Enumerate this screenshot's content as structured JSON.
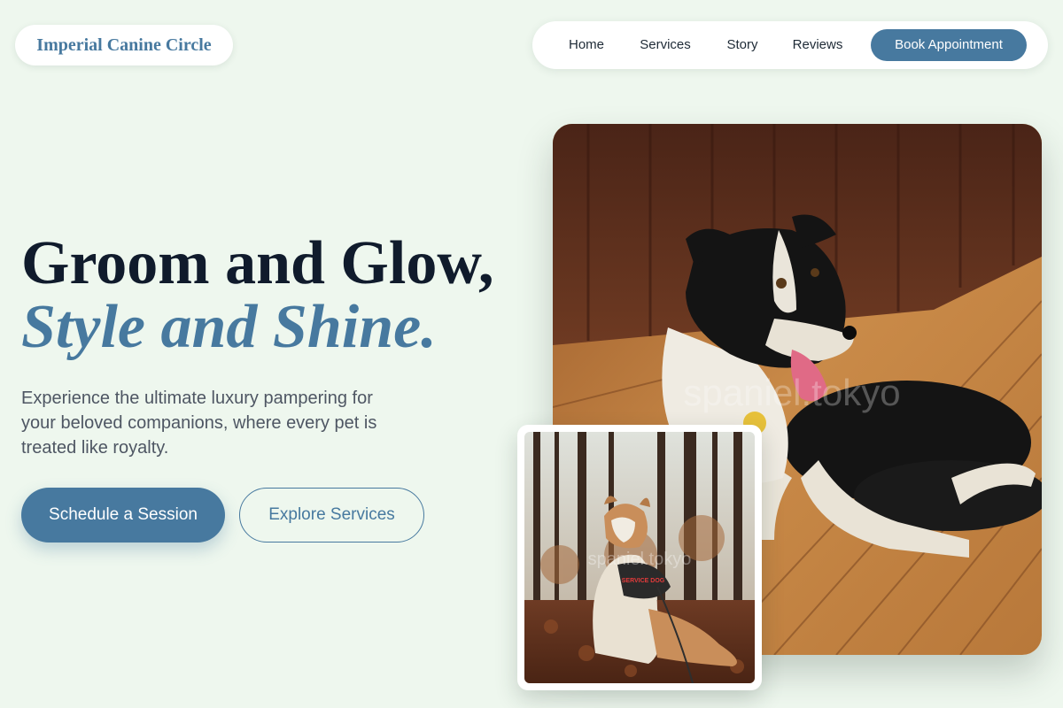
{
  "brand": {
    "name": "Imperial Canine Circle",
    "color": "#47799f"
  },
  "nav": {
    "items": [
      {
        "label": "Home"
      },
      {
        "label": "Services"
      },
      {
        "label": "Story"
      },
      {
        "label": "Reviews"
      }
    ],
    "cta_label": "Book Appointment"
  },
  "hero": {
    "headline_line1": "Groom and Glow,",
    "headline_line2": "Style and Shine.",
    "subtext": "Experience the ultimate luxury pampering for your beloved companions, where every pet is treated like royalty.",
    "primary_button": "Schedule a Session",
    "secondary_button": "Explore Services"
  },
  "images": {
    "main_watermark": "spaniel.tokyo",
    "small_watermark": "spaniel.tokyo",
    "vest_text": "SERVICE DOG"
  },
  "colors": {
    "background": "#eef7ee",
    "accent": "#47799f",
    "heading": "#101b2c",
    "body_text": "#4e5663"
  }
}
